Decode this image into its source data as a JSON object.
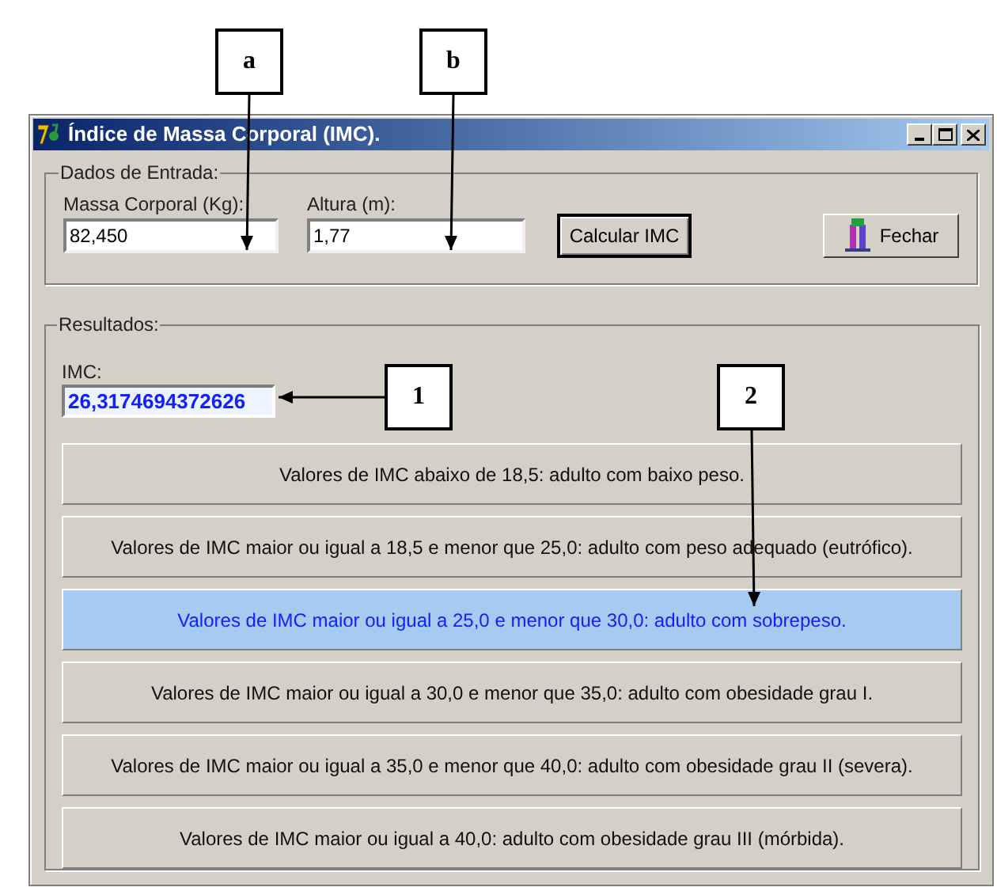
{
  "window": {
    "title": "Índice de Massa Corporal (IMC)."
  },
  "input_group": {
    "title": "Dados de Entrada:",
    "fields": [
      {
        "label": "Massa Corporal (Kg):",
        "value": "82,450"
      },
      {
        "label": "Altura (m):",
        "value": "1,77"
      }
    ],
    "buttons": [
      {
        "label": "Calcular IMC",
        "kind": "default"
      },
      {
        "label": "Fechar",
        "kind": "icon"
      }
    ]
  },
  "results_group": {
    "title": "Resultados:",
    "imc_label": "IMC:",
    "imc_value": "26,3174694372626",
    "ranges": [
      {
        "text": "Valores de IMC abaixo de 18,5: adulto com baixo peso.",
        "selected": false
      },
      {
        "text": "Valores de IMC maior ou igual a 18,5 e menor que 25,0: adulto com peso adequado (eutrófico).",
        "selected": false
      },
      {
        "text": "Valores de IMC maior ou igual a 25,0 e menor que 30,0: adulto com sobrepeso.",
        "selected": true
      },
      {
        "text": "Valores de IMC maior ou igual a 30,0 e menor que 35,0: adulto com obesidade grau I.",
        "selected": false
      },
      {
        "text": "Valores de IMC maior ou igual a 35,0 e menor que 40,0: adulto com obesidade grau II (severa).",
        "selected": false
      },
      {
        "text": "Valores de IMC maior ou igual a 40,0: adulto com obesidade grau III (mórbida).",
        "selected": false
      }
    ]
  },
  "callouts": [
    {
      "label": "a",
      "kind": "down"
    },
    {
      "label": "b",
      "kind": "down"
    },
    {
      "label": "1",
      "kind": "left"
    },
    {
      "label": "2",
      "kind": "down"
    }
  ]
}
